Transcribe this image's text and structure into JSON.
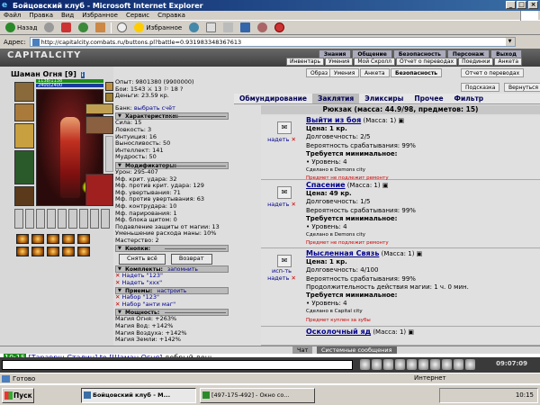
{
  "window": {
    "title": "Бойцовский клуб - Microsoft Internet Explorer",
    "minimize": "_",
    "maximize": "□",
    "close": "×"
  },
  "menu": [
    "Файл",
    "Правка",
    "Вид",
    "Избранное",
    "Сервис",
    "Справка"
  ],
  "toolbar": {
    "back": "Назад",
    "favorites": "Избранное"
  },
  "address": {
    "label": "Адрес:",
    "url": "http://capitalcity.combats.ru/buttons.pl?battle=0.931983348367613"
  },
  "site": {
    "logo": "CAPITALCITY",
    "topnav": [
      "Знания",
      "Общение",
      "Безопасность",
      "Персонаж",
      "Выход"
    ],
    "subnav": [
      "Инвентарь",
      "Умения",
      "Мой Скролл",
      "Отчет о переводах",
      "Поединки",
      "Анкета"
    ]
  },
  "character": {
    "name": "Шаман Огня",
    "level": "[9]",
    "hp": "1138/1138",
    "mp": "2400/2400",
    "exp_line": "Опыт: 9801380 (9900000)",
    "battles_line": "Бои: 1543 ⚔ 13 ⚐ 18 ?",
    "money_line": "Деньги: 23.59 кр.",
    "bank_label": "Банк:",
    "bank_link": "выбрать счёт"
  },
  "stats": {
    "header": "Характеристики:",
    "lines": [
      "Сила: 15",
      "Ловкость: 3",
      "Интуиция: 16",
      "Выносливость: 50",
      "Интеллект: 141",
      "Мудрость: 50"
    ]
  },
  "modifiers": {
    "header": "Модификаторы:",
    "lines": [
      "Урон: 295-407",
      "Мф. крит. удара: 32",
      "Мф. против крит. удара: 129",
      "Мф. увертывания: 71",
      "Мф. против увертывания: 63",
      "Мф. контрудара: 10",
      "Мф. парирования: 1",
      "Мф. блока щитом: 0",
      "Подавление защиты от магии: 13",
      "Уменьшение расхода маны: 10%",
      "Мастерство: 2"
    ]
  },
  "knopki": {
    "header": "Кнопки:",
    "remove_all": "Снять всё",
    "return": "Возврат"
  },
  "komplekty": {
    "header": "Комплекты:",
    "link": "запомнить",
    "items": [
      "Надеть \"123\"",
      "Надеть \"ххх\""
    ]
  },
  "priemy": {
    "header": "Приемы:",
    "link": "настроить",
    "items": [
      "Набор \"123\"",
      "Набор \"анти маг\""
    ]
  },
  "moshnost": {
    "header": "Мощность:",
    "lines": [
      "Магия Огня: +263%",
      "Магия Вод: +142%",
      "Магия Воздуха: +142%",
      "Магия Земли: +142%"
    ]
  },
  "right_top_tabs": [
    "Образ",
    "Умения",
    "Анкета",
    "Безопасность",
    "Отчет о переводах",
    "Подсказка",
    "Вернуться"
  ],
  "category_tabs": [
    "Обмундирование",
    "Заклятия",
    "Эликсиры",
    "Прочее",
    "Фильтр"
  ],
  "rucksack": "Рюкзак (масса: 44.9/98, предметов: 15)",
  "items": [
    {
      "name": "Выйти из боя",
      "mass": "(Масса: 1)",
      "action": "надеть",
      "price": "Цена: 1 кр.",
      "durability": "Долговечность: 2/5",
      "chance": "Вероятность срабатывания: 99%",
      "req_head": "Требуется минимальное:",
      "req": "• Уровень: 4",
      "made": "Сделано в Demons city",
      "warn": "Предмет не подлежит ремонту"
    },
    {
      "name": "Спасение",
      "mass": "(Масса: 1)",
      "action": "надеть",
      "price": "Цена: 49 кр.",
      "durability": "Долговечность: 1/5",
      "chance": "Вероятность срабатывания: 99%",
      "req_head": "Требуется минимальное:",
      "req": "• Уровень: 4",
      "made": "Сделано в Demons city",
      "warn": "Предмет не подлежит ремонту"
    },
    {
      "name": "Мысленная Связь",
      "mass": "(Масса: 1)",
      "action": "исп-ть надеть",
      "price": "Цена: 1 кр.",
      "durability": "Долговечность: 4/100",
      "chance": "Вероятность срабатывания: 99%",
      "duration": "Продолжительность действия магии: 1 ч. 0 мин.",
      "req_head": "Требуется минимальное:",
      "req": "• Уровень: 4",
      "made": "Сделано в Capital city",
      "warn": "Предмет куплен за зубы"
    },
    {
      "name": "Осколочный яд",
      "mass": "(Масса: 1)"
    }
  ],
  "chat": {
    "tab_chat": "Чат",
    "tab_sys": "Системные сообщения",
    "time": "10:15",
    "from": "[Тараврщ Сталин]",
    "to_word": "to",
    "to": "[Шаман Огня]",
    "msg": "добрый день",
    "clock": "09:07:09"
  },
  "status": {
    "left": "Готово",
    "zone": "Интернет"
  },
  "taskbar": {
    "start": "Пуск",
    "tasks": [
      "Бойцовский клуб - М...",
      "[497-175-492] - Окно со..."
    ],
    "tray": "10:15"
  }
}
